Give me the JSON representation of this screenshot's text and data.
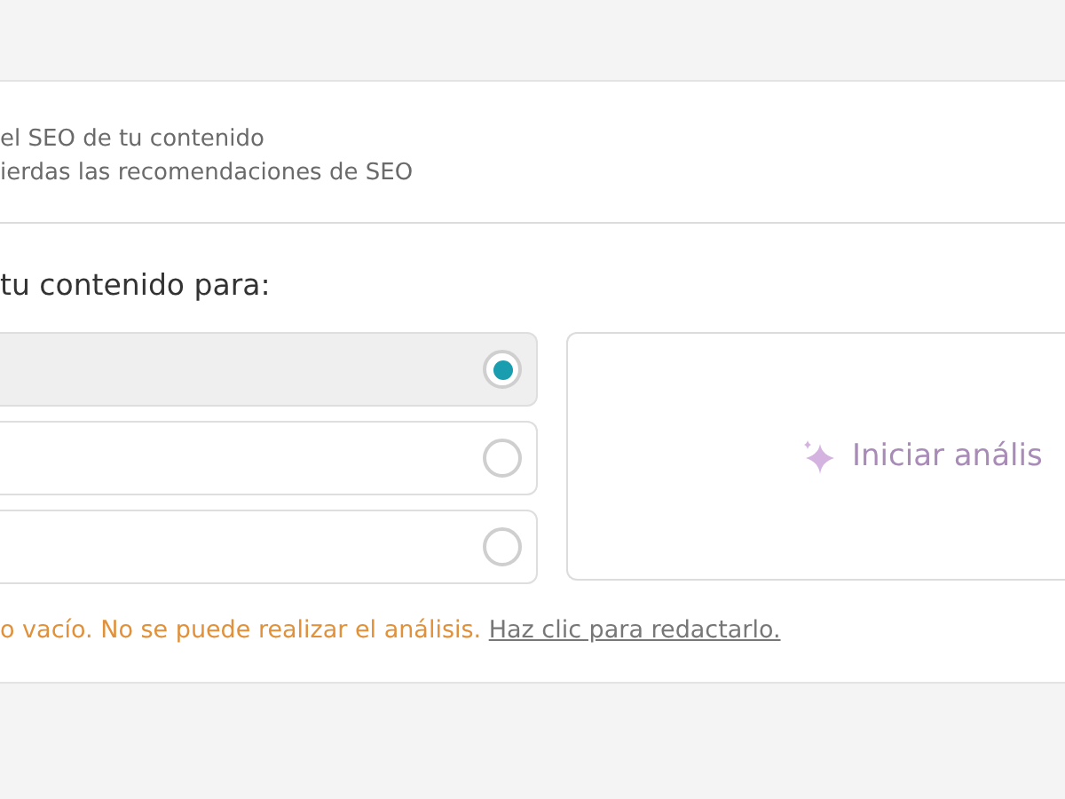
{
  "intro": {
    "lines": [
      "el SEO de tu contenido",
      "ierdas las recomendaciones de SEO"
    ]
  },
  "heading": "tu contenido para:",
  "options": [
    {
      "selected": true
    },
    {
      "selected": false
    },
    {
      "selected": false
    }
  ],
  "analyze_button": {
    "label": "Iniciar anális",
    "disabled": true
  },
  "warning": {
    "message": "o vacío. No se puede realizar el análisis.",
    "link": "Haz clic para redactarlo."
  }
}
